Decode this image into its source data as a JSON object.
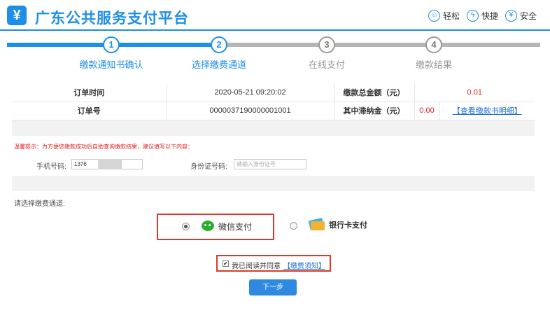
{
  "header": {
    "logo_glyph": "¥",
    "title": "广东公共服务支付平台",
    "features": [
      {
        "icon": "smile-icon",
        "label": "轻松"
      },
      {
        "icon": "lightning-icon",
        "label": "快捷"
      },
      {
        "icon": "shield-icon",
        "label": "安全"
      }
    ]
  },
  "steps": [
    {
      "number": "1",
      "label": "缴款通知书确认",
      "state": "done"
    },
    {
      "number": "2",
      "label": "选择缴费通道",
      "state": "current"
    },
    {
      "number": "3",
      "label": "在线支付",
      "state": "todo"
    },
    {
      "number": "4",
      "label": "缴款结果",
      "state": "todo"
    }
  ],
  "order": {
    "time_label": "订单时间",
    "time_value": "2020-05-21 09:20:02",
    "total_label": "缴款总金额（元）",
    "total_value": "0.01",
    "number_label": "订单号",
    "number_value": "0000037190000001001",
    "late_fee_label": "其中滞纳金（元）",
    "late_fee_value": "0.00",
    "detail_link": "【查看缴款书明细】"
  },
  "tip": "温馨提示：为方便您缴款成功后自助查询缴款结果，建议填写以下内容：",
  "form": {
    "phone_label": "手机号码:",
    "phone_value": "1376",
    "id_label": "身份证号码:",
    "id_placeholder": "请输入身份证号"
  },
  "channel": {
    "label": "请选择缴费通道:",
    "wechat_label": "微信支付",
    "bank_label": "银行卡支付",
    "selected": "wechat"
  },
  "agreement": {
    "checked": true,
    "text": "我已阅读并同意",
    "link": "【缴费须知】"
  },
  "next_button": "下一步",
  "colors": {
    "brand_blue": "#1e8fe6",
    "highlight_red": "#d93a2b",
    "amount_red": "#e02020",
    "wechat_green": "#2aae2f"
  }
}
